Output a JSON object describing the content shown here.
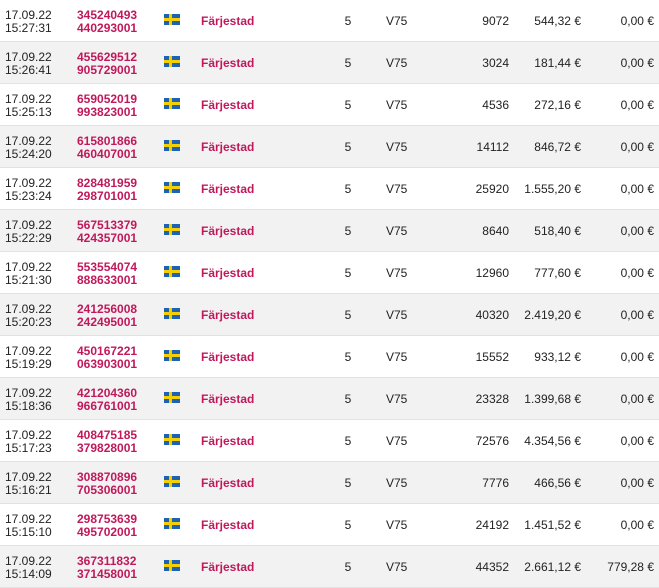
{
  "rows": [
    {
      "date": "17.09.22",
      "time": "15:27:31",
      "ticket_a": "345240493",
      "ticket_b": "440293001",
      "flag": "sweden-flag-icon",
      "track": "Färjestad",
      "race": "5",
      "game": "V75",
      "units": "9072",
      "stake": "544,32 €",
      "win": "0,00 €"
    },
    {
      "date": "17.09.22",
      "time": "15:26:41",
      "ticket_a": "455629512",
      "ticket_b": "905729001",
      "flag": "sweden-flag-icon",
      "track": "Färjestad",
      "race": "5",
      "game": "V75",
      "units": "3024",
      "stake": "181,44 €",
      "win": "0,00 €"
    },
    {
      "date": "17.09.22",
      "time": "15:25:13",
      "ticket_a": "659052019",
      "ticket_b": "993823001",
      "flag": "sweden-flag-icon",
      "track": "Färjestad",
      "race": "5",
      "game": "V75",
      "units": "4536",
      "stake": "272,16 €",
      "win": "0,00 €"
    },
    {
      "date": "17.09.22",
      "time": "15:24:20",
      "ticket_a": "615801866",
      "ticket_b": "460407001",
      "flag": "sweden-flag-icon",
      "track": "Färjestad",
      "race": "5",
      "game": "V75",
      "units": "14112",
      "stake": "846,72 €",
      "win": "0,00 €"
    },
    {
      "date": "17.09.22",
      "time": "15:23:24",
      "ticket_a": "828481959",
      "ticket_b": "298701001",
      "flag": "sweden-flag-icon",
      "track": "Färjestad",
      "race": "5",
      "game": "V75",
      "units": "25920",
      "stake": "1.555,20 €",
      "win": "0,00 €"
    },
    {
      "date": "17.09.22",
      "time": "15:22:29",
      "ticket_a": "567513379",
      "ticket_b": "424357001",
      "flag": "sweden-flag-icon",
      "track": "Färjestad",
      "race": "5",
      "game": "V75",
      "units": "8640",
      "stake": "518,40 €",
      "win": "0,00 €"
    },
    {
      "date": "17.09.22",
      "time": "15:21:30",
      "ticket_a": "553554074",
      "ticket_b": "888633001",
      "flag": "sweden-flag-icon",
      "track": "Färjestad",
      "race": "5",
      "game": "V75",
      "units": "12960",
      "stake": "777,60 €",
      "win": "0,00 €"
    },
    {
      "date": "17.09.22",
      "time": "15:20:23",
      "ticket_a": "241256008",
      "ticket_b": "242495001",
      "flag": "sweden-flag-icon",
      "track": "Färjestad",
      "race": "5",
      "game": "V75",
      "units": "40320",
      "stake": "2.419,20 €",
      "win": "0,00 €"
    },
    {
      "date": "17.09.22",
      "time": "15:19:29",
      "ticket_a": "450167221",
      "ticket_b": "063903001",
      "flag": "sweden-flag-icon",
      "track": "Färjestad",
      "race": "5",
      "game": "V75",
      "units": "15552",
      "stake": "933,12 €",
      "win": "0,00 €"
    },
    {
      "date": "17.09.22",
      "time": "15:18:36",
      "ticket_a": "421204360",
      "ticket_b": "966761001",
      "flag": "sweden-flag-icon",
      "track": "Färjestad",
      "race": "5",
      "game": "V75",
      "units": "23328",
      "stake": "1.399,68 €",
      "win": "0,00 €"
    },
    {
      "date": "17.09.22",
      "time": "15:17:23",
      "ticket_a": "408475185",
      "ticket_b": "379828001",
      "flag": "sweden-flag-icon",
      "track": "Färjestad",
      "race": "5",
      "game": "V75",
      "units": "72576",
      "stake": "4.354,56 €",
      "win": "0,00 €"
    },
    {
      "date": "17.09.22",
      "time": "15:16:21",
      "ticket_a": "308870896",
      "ticket_b": "705306001",
      "flag": "sweden-flag-icon",
      "track": "Färjestad",
      "race": "5",
      "game": "V75",
      "units": "7776",
      "stake": "466,56 €",
      "win": "0,00 €"
    },
    {
      "date": "17.09.22",
      "time": "15:15:10",
      "ticket_a": "298753639",
      "ticket_b": "495702001",
      "flag": "sweden-flag-icon",
      "track": "Färjestad",
      "race": "5",
      "game": "V75",
      "units": "24192",
      "stake": "1.451,52 €",
      "win": "0,00 €"
    },
    {
      "date": "17.09.22",
      "time": "15:14:09",
      "ticket_a": "367311832",
      "ticket_b": "371458001",
      "flag": "sweden-flag-icon",
      "track": "Färjestad",
      "race": "5",
      "game": "V75",
      "units": "44352",
      "stake": "2.661,12 €",
      "win": "779,28 €"
    }
  ],
  "colors": {
    "link": "#c1185b",
    "row_alt": "#f2f2f2",
    "flag_blue": "#1f62b5",
    "flag_yellow": "#f5d000"
  }
}
